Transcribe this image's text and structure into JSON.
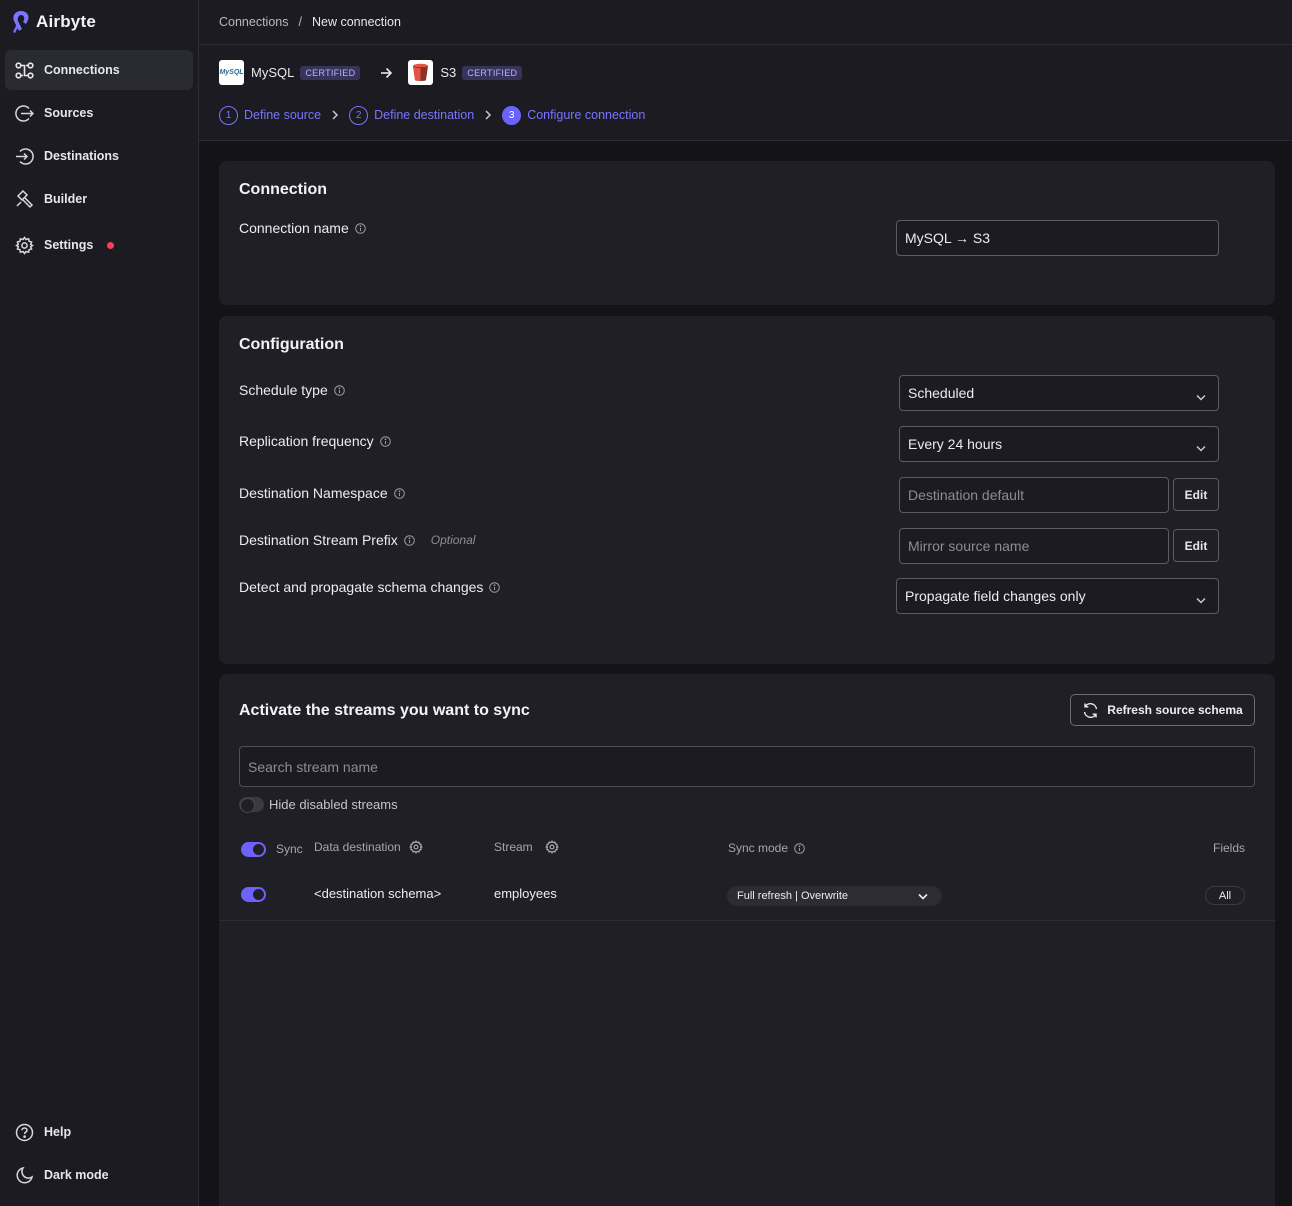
{
  "app": {
    "name": "Airbyte"
  },
  "sidebar": {
    "items": [
      {
        "label": "Connections",
        "icon": "connections-icon",
        "active": true
      },
      {
        "label": "Sources",
        "icon": "source-icon"
      },
      {
        "label": "Destinations",
        "icon": "destination-icon"
      },
      {
        "label": "Builder",
        "icon": "builder-icon"
      },
      {
        "label": "Settings",
        "icon": "gear-icon",
        "notification": true
      }
    ],
    "bottom": [
      {
        "label": "Help",
        "icon": "help-icon"
      },
      {
        "label": "Dark mode",
        "icon": "moon-icon"
      }
    ]
  },
  "breadcrumb": {
    "parent": "Connections",
    "separator": "/",
    "current": "New connection"
  },
  "route": {
    "source": {
      "name": "MySQL",
      "badge": "CERTIFIED",
      "logo_text": "MySQL"
    },
    "destination": {
      "name": "S3",
      "badge": "CERTIFIED"
    }
  },
  "steps": [
    {
      "num": "1",
      "label": "Define source"
    },
    {
      "num": "2",
      "label": "Define destination"
    },
    {
      "num": "3",
      "label": "Configure connection",
      "current": true
    }
  ],
  "connection": {
    "title": "Connection",
    "name_label": "Connection name",
    "name_value": "MySQL → S3"
  },
  "configuration": {
    "title": "Configuration",
    "schedule_type": {
      "label": "Schedule type",
      "value": "Scheduled"
    },
    "replication_frequency": {
      "label": "Replication frequency",
      "value": "Every 24 hours"
    },
    "namespace": {
      "label": "Destination Namespace",
      "placeholder": "Destination default",
      "edit": "Edit"
    },
    "prefix": {
      "label": "Destination Stream Prefix",
      "optional": "Optional",
      "placeholder": "Mirror source name",
      "edit": "Edit"
    },
    "schema_changes": {
      "label": "Detect and propagate schema changes",
      "value": "Propagate field changes only"
    }
  },
  "streams": {
    "title": "Activate the streams you want to sync",
    "refresh_label": "Refresh source schema",
    "search_placeholder": "Search stream name",
    "hide_disabled_label": "Hide disabled streams",
    "hide_disabled_on": false,
    "headers": {
      "sync": "Sync",
      "data_destination": "Data destination",
      "stream": "Stream",
      "sync_mode": "Sync mode",
      "fields": "Fields"
    },
    "rows": [
      {
        "enabled": true,
        "destination": "<destination schema>",
        "stream": "employees",
        "sync_mode": "Full refresh | Overwrite",
        "fields": "All"
      }
    ]
  },
  "colors": {
    "accent": "#6c63ff",
    "notification": "#ff3b5c"
  }
}
